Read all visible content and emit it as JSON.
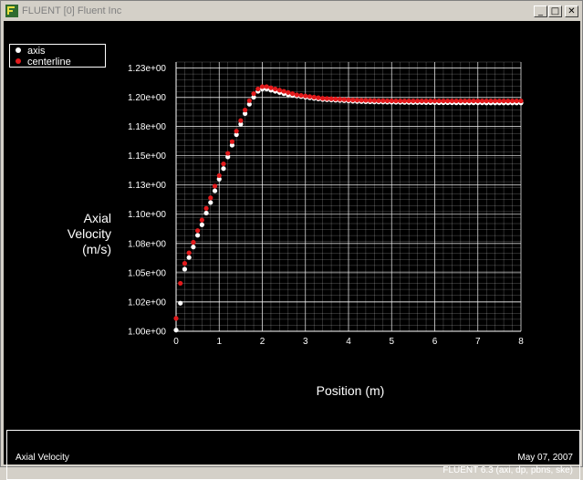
{
  "window": {
    "title": "FLUENT [0] Fluent Inc",
    "minimize_label": "_",
    "maximize_label": "□",
    "close_label": "✕",
    "icon": "fluent-app-icon"
  },
  "footer": {
    "quantity": "Axial Velocity",
    "date": "May 07, 2007",
    "version": "FLUENT 6.3 (axi, dp, pbns, ske)"
  },
  "colors": {
    "axis_series": "#ffffff",
    "centerline_series": "#e31a1c",
    "grid": "#ffffff",
    "background": "#000000"
  },
  "chart_data": {
    "type": "scatter",
    "title": "",
    "xlabel": "Position (m)",
    "ylabel_lines": [
      "Axial",
      "Velocity",
      "(m/s)"
    ],
    "xlim": [
      0,
      8
    ],
    "ylim": [
      1.0,
      1.23
    ],
    "x_ticks": [
      0,
      1,
      2,
      3,
      4,
      5,
      6,
      7,
      8
    ],
    "x_tick_labels": [
      "0",
      "1",
      "2",
      "3",
      "4",
      "5",
      "6",
      "7",
      "8"
    ],
    "y_ticks": [
      1.0,
      1.025,
      1.05,
      1.075,
      1.1,
      1.125,
      1.15,
      1.175,
      1.2,
      1.225
    ],
    "y_tick_labels": [
      "1.00e+00",
      "1.02e+00",
      "1.05e+00",
      "1.08e+00",
      "1.10e+00",
      "1.13e+00",
      "1.15e+00",
      "1.18e+00",
      "1.20e+00",
      "1.23e+00"
    ],
    "grid": true,
    "legend_position": "top-left",
    "series": [
      {
        "name": "axis",
        "color": "#ffffff",
        "x": [
          0,
          0.1,
          0.2,
          0.3,
          0.4,
          0.5,
          0.6,
          0.7,
          0.8,
          0.9,
          1.0,
          1.1,
          1.2,
          1.3,
          1.4,
          1.5,
          1.6,
          1.7,
          1.8,
          1.9,
          2.0,
          2.1,
          2.2,
          2.3,
          2.4,
          2.5,
          2.6,
          2.7,
          2.8,
          2.9,
          3.0,
          3.1,
          3.2,
          3.3,
          3.4,
          3.5,
          3.6,
          3.7,
          3.8,
          3.9,
          4.0,
          4.1,
          4.2,
          4.3,
          4.4,
          4.5,
          4.6,
          4.7,
          4.8,
          4.9,
          5.0,
          5.1,
          5.2,
          5.3,
          5.4,
          5.5,
          5.6,
          5.7,
          5.8,
          5.9,
          6.0,
          6.1,
          6.2,
          6.3,
          6.4,
          6.5,
          6.6,
          6.7,
          6.8,
          6.9,
          7.0,
          7.1,
          7.2,
          7.3,
          7.4,
          7.5,
          7.6,
          7.7,
          7.8,
          7.9,
          8.0
        ],
        "y": [
          1.001,
          1.024,
          1.053,
          1.063,
          1.072,
          1.082,
          1.091,
          1.101,
          1.11,
          1.12,
          1.13,
          1.139,
          1.149,
          1.159,
          1.168,
          1.177,
          1.186,
          1.194,
          1.2,
          1.205,
          1.207,
          1.207,
          1.206,
          1.205,
          1.204,
          1.203,
          1.202,
          1.2015,
          1.201,
          1.2005,
          1.2,
          1.1995,
          1.199,
          1.1985,
          1.198,
          1.1978,
          1.1976,
          1.1974,
          1.1972,
          1.197,
          1.1968,
          1.1966,
          1.1964,
          1.1963,
          1.1962,
          1.1961,
          1.196,
          1.196,
          1.1959,
          1.1958,
          1.1958,
          1.1957,
          1.1957,
          1.1956,
          1.1956,
          1.1955,
          1.1955,
          1.1955,
          1.1954,
          1.1954,
          1.1954,
          1.1953,
          1.1953,
          1.1953,
          1.1953,
          1.1952,
          1.1952,
          1.1952,
          1.1952,
          1.1952,
          1.1952,
          1.1952,
          1.1951,
          1.1951,
          1.1951,
          1.1951,
          1.1951,
          1.1951,
          1.1951,
          1.1951,
          1.1951
        ]
      },
      {
        "name": "centerline",
        "color": "#e31a1c",
        "x": [
          0,
          0.1,
          0.2,
          0.3,
          0.4,
          0.5,
          0.6,
          0.7,
          0.8,
          0.9,
          1.0,
          1.1,
          1.2,
          1.3,
          1.4,
          1.5,
          1.6,
          1.7,
          1.8,
          1.9,
          2.0,
          2.1,
          2.2,
          2.3,
          2.4,
          2.5,
          2.6,
          2.7,
          2.8,
          2.9,
          3.0,
          3.1,
          3.2,
          3.3,
          3.4,
          3.5,
          3.6,
          3.7,
          3.8,
          3.9,
          4.0,
          4.1,
          4.2,
          4.3,
          4.4,
          4.5,
          4.6,
          4.7,
          4.8,
          4.9,
          5.0,
          5.1,
          5.2,
          5.3,
          5.4,
          5.5,
          5.6,
          5.7,
          5.8,
          5.9,
          6.0,
          6.1,
          6.2,
          6.3,
          6.4,
          6.5,
          6.6,
          6.7,
          6.8,
          6.9,
          7.0,
          7.1,
          7.2,
          7.3,
          7.4,
          7.5,
          7.6,
          7.7,
          7.8,
          7.9,
          8.0
        ],
        "y": [
          1.011,
          1.041,
          1.058,
          1.067,
          1.076,
          1.086,
          1.095,
          1.105,
          1.114,
          1.124,
          1.133,
          1.143,
          1.152,
          1.162,
          1.171,
          1.18,
          1.189,
          1.197,
          1.203,
          1.207,
          1.209,
          1.209,
          1.208,
          1.207,
          1.206,
          1.205,
          1.204,
          1.203,
          1.202,
          1.2015,
          1.201,
          1.2005,
          1.2,
          1.1995,
          1.199,
          1.1988,
          1.1986,
          1.1984,
          1.1982,
          1.198,
          1.1978,
          1.1976,
          1.1975,
          1.1974,
          1.1973,
          1.1972,
          1.1971,
          1.197,
          1.197,
          1.1969,
          1.1969,
          1.1968,
          1.1968,
          1.1968,
          1.1968,
          1.1968,
          1.1968,
          1.1968,
          1.1968,
          1.1968,
          1.1968,
          1.1968,
          1.1968,
          1.1968,
          1.1968,
          1.1968,
          1.1968,
          1.1968,
          1.1968,
          1.1968,
          1.1968,
          1.1968,
          1.1968,
          1.1968,
          1.1968,
          1.1968,
          1.1968,
          1.1968,
          1.1968,
          1.1968,
          1.1968
        ]
      }
    ]
  }
}
